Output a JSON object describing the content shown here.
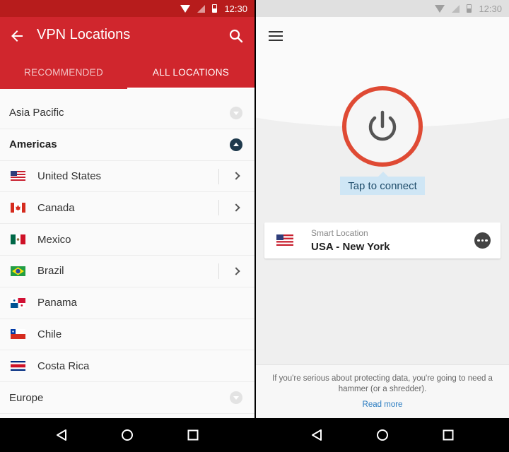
{
  "status_bar": {
    "time": "12:30",
    "icons": [
      "wifi-icon",
      "signal-icon",
      "battery-icon"
    ]
  },
  "left_screen": {
    "app_bar": {
      "title": "VPN Locations",
      "back_icon": "arrow-left-icon",
      "search_icon": "search-icon"
    },
    "tabs": [
      {
        "label": "RECOMMENDED",
        "active": false
      },
      {
        "label": "ALL LOCATIONS",
        "active": true
      }
    ],
    "regions": [
      {
        "label": "Asia Pacific",
        "expanded": false
      },
      {
        "label": "Americas",
        "expanded": true
      },
      {
        "label": "Europe",
        "expanded": false
      }
    ],
    "countries": [
      {
        "name": "United States",
        "flag": "us-flag-icon",
        "has_submenu": true
      },
      {
        "name": "Canada",
        "flag": "canada-flag-icon",
        "has_submenu": true
      },
      {
        "name": "Mexico",
        "flag": "mexico-flag-icon",
        "has_submenu": false
      },
      {
        "name": "Brazil",
        "flag": "brazil-flag-icon",
        "has_submenu": true
      },
      {
        "name": "Panama",
        "flag": "panama-flag-icon",
        "has_submenu": false
      },
      {
        "name": "Chile",
        "flag": "chile-flag-icon",
        "has_submenu": false
      },
      {
        "name": "Costa Rica",
        "flag": "costa-rica-flag-icon",
        "has_submenu": false
      }
    ]
  },
  "right_screen": {
    "menu_icon": "hamburger-menu-icon",
    "power_icon": "power-icon",
    "connect_hint": "Tap to connect",
    "location_card": {
      "subtitle": "Smart Location",
      "title": "USA - New York",
      "flag": "us-flag-icon",
      "more_icon": "more-options-icon"
    },
    "footer": {
      "message": "If you're serious about protecting data, you're going to need a hammer (or a shredder).",
      "link": "Read more"
    }
  },
  "nav_bar": {
    "buttons": [
      "back-nav-icon",
      "home-nav-icon",
      "recents-nav-icon"
    ]
  },
  "colors": {
    "brand_red": "#d0262d",
    "status_red": "#b71c1c",
    "power_ring": "#df4a34",
    "tooltip_bg": "#cfe6f5",
    "link_blue": "#2a7cc1"
  }
}
